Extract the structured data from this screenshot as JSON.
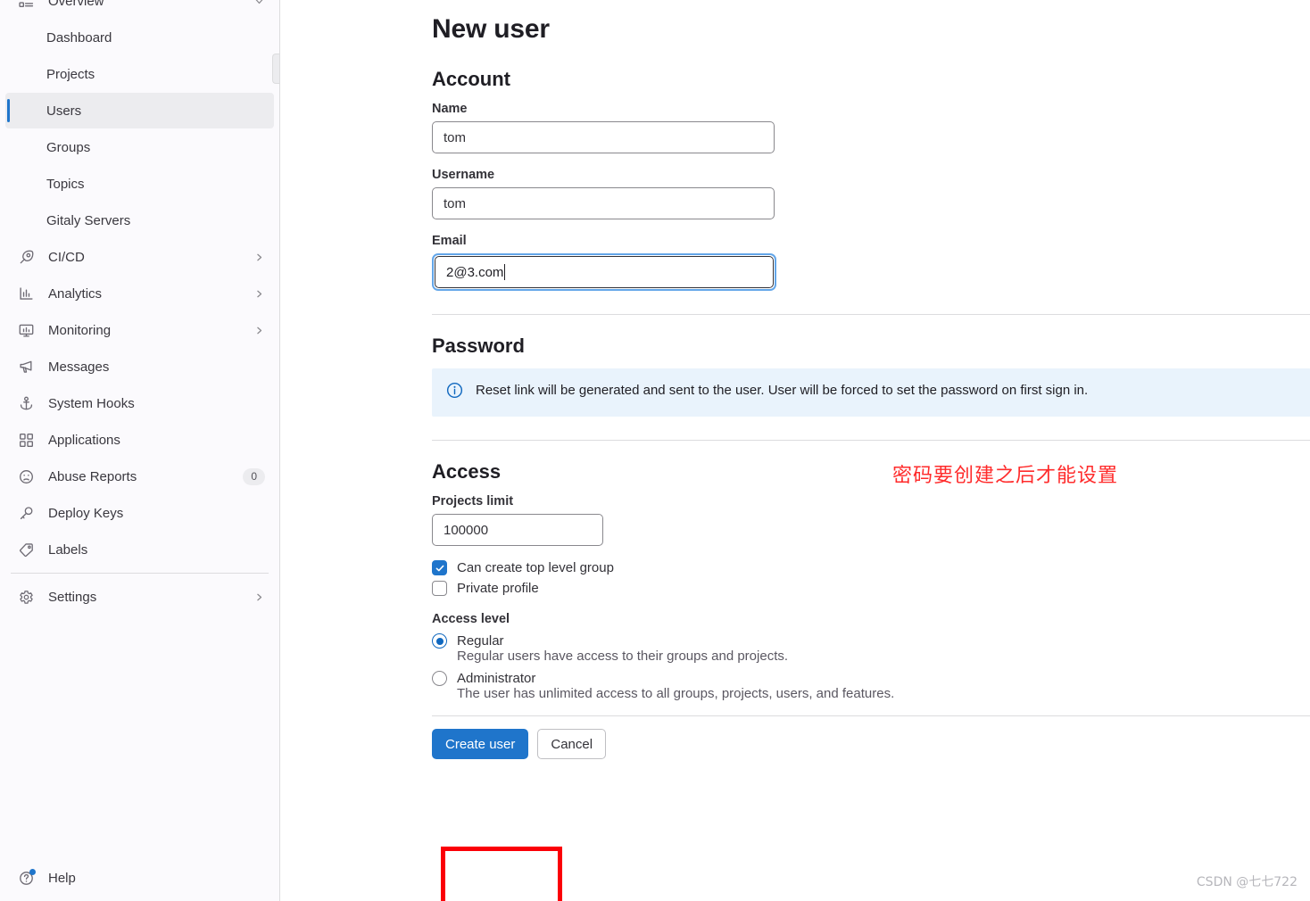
{
  "sidebar": {
    "items": [
      {
        "label": "Overview",
        "icon": "overview-icon",
        "chevron": "down",
        "type": "top"
      },
      {
        "label": "Dashboard",
        "icon": "",
        "type": "sub"
      },
      {
        "label": "Projects",
        "icon": "",
        "type": "sub"
      },
      {
        "label": "Users",
        "icon": "",
        "type": "sub",
        "active": true
      },
      {
        "label": "Groups",
        "icon": "",
        "type": "sub"
      },
      {
        "label": "Topics",
        "icon": "",
        "type": "sub"
      },
      {
        "label": "Gitaly Servers",
        "icon": "",
        "type": "sub"
      },
      {
        "label": "CI/CD",
        "icon": "rocket-icon",
        "chevron": "right",
        "type": "top"
      },
      {
        "label": "Analytics",
        "icon": "chart-icon",
        "chevron": "right",
        "type": "top"
      },
      {
        "label": "Monitoring",
        "icon": "monitor-icon",
        "chevron": "right",
        "type": "top"
      },
      {
        "label": "Messages",
        "icon": "megaphone-icon",
        "type": "top"
      },
      {
        "label": "System Hooks",
        "icon": "anchor-icon",
        "type": "top"
      },
      {
        "label": "Applications",
        "icon": "grid-icon",
        "type": "top"
      },
      {
        "label": "Abuse Reports",
        "icon": "frown-icon",
        "badge": "0",
        "type": "top"
      },
      {
        "label": "Deploy Keys",
        "icon": "key-icon",
        "type": "top"
      },
      {
        "label": "Labels",
        "icon": "tag-icon",
        "type": "top"
      },
      {
        "label": "Settings",
        "icon": "gear-icon",
        "chevron": "right",
        "type": "top",
        "divider_before": true
      }
    ],
    "help_label": "Help"
  },
  "page": {
    "title": "New user"
  },
  "account": {
    "section_title": "Account",
    "name_label": "Name",
    "name_value": "tom",
    "username_label": "Username",
    "username_value": "tom",
    "email_label": "Email",
    "email_value": "2@3.com"
  },
  "password": {
    "section_title": "Password",
    "alert_text": "Reset link will be generated and sent to the user. User will be forced to set the password on first sign in."
  },
  "access": {
    "section_title": "Access",
    "projects_limit_label": "Projects limit",
    "projects_limit_value": "100000",
    "checkbox_top_level_group": "Can create top level group",
    "checkbox_top_level_group_checked": true,
    "checkbox_private_profile": "Private profile",
    "checkbox_private_profile_checked": false,
    "access_level_label": "Access level",
    "regular_label": "Regular",
    "regular_desc": "Regular users have access to their groups and projects.",
    "regular_selected": true,
    "administrator_label": "Administrator",
    "administrator_desc": "The user has unlimited access to all groups, projects, users, and features.",
    "administrator_selected": false
  },
  "actions": {
    "create_label": "Create user",
    "cancel_label": "Cancel"
  },
  "annotations": {
    "red_note": "密码要创建之后才能设置",
    "red_note_color": "#ff2b2b"
  },
  "watermark": {
    "text": "CSDN @七七722"
  },
  "colors": {
    "accent": "#1f75cb",
    "info_bg": "#e9f3fc",
    "info_icon": "#1068bf",
    "sidebar_bg": "#fbfafd",
    "active_bg": "#ececef",
    "annotation_red": "#fb0007"
  }
}
